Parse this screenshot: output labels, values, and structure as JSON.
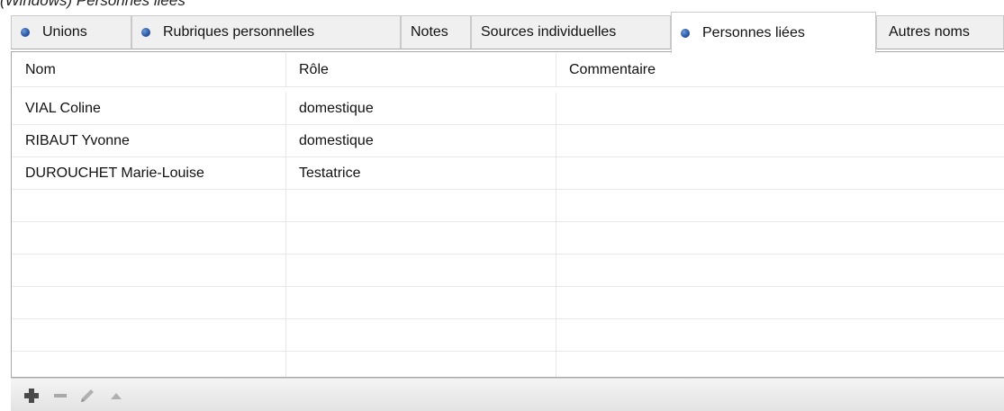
{
  "caption": "(Windows) Personnes liées",
  "tabs": [
    {
      "label": "Unions",
      "dot": true,
      "active": false
    },
    {
      "label": "Rubriques personnelles",
      "dot": true,
      "active": false
    },
    {
      "label": "Notes",
      "dot": false,
      "active": false
    },
    {
      "label": "Sources individuelles",
      "dot": false,
      "active": false
    },
    {
      "label": "Personnes liées",
      "dot": true,
      "active": true
    },
    {
      "label": "Autres noms",
      "dot": false,
      "active": false
    }
  ],
  "table": {
    "columns": [
      "Nom",
      "Rôle",
      "Commentaire"
    ],
    "rows": [
      [
        "VIAL Coline",
        "domestique",
        ""
      ],
      [
        "RIBAUT Yvonne",
        "domestique",
        ""
      ],
      [
        "DUROUCHET Marie-Louise",
        "Testatrice",
        ""
      ]
    ]
  },
  "toolbar": {
    "icons": [
      "add-icon",
      "remove-icon",
      "edit-icon",
      "move-up-icon"
    ]
  },
  "colors": {
    "dot": "#2b5aa8",
    "tab_bg": "#f0f0f0",
    "border": "#a8a8a8",
    "grid_line": "#e7e7e7",
    "toolbar_bg": "#e8e8e8"
  }
}
